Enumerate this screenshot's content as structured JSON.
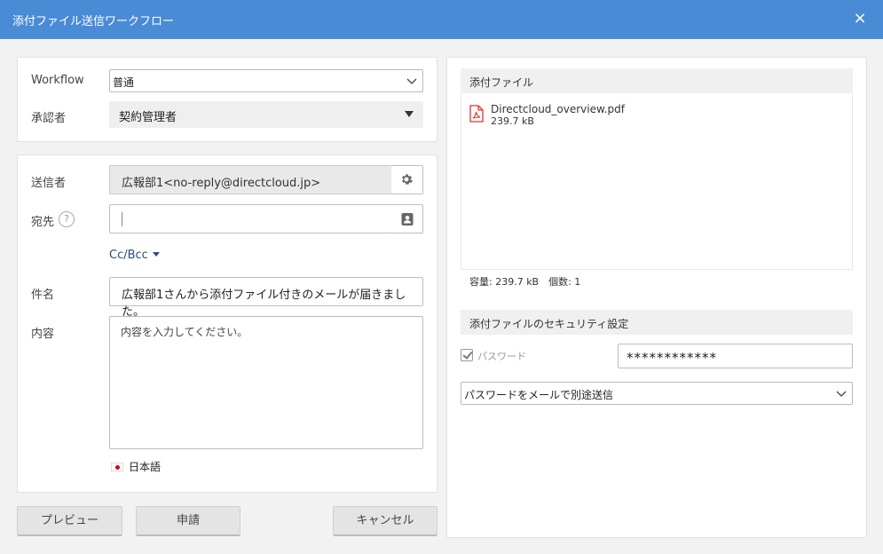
{
  "window": {
    "title": "添付ファイル送信ワークフロー",
    "close_label": "×"
  },
  "workflow": {
    "label": "Workflow",
    "value": "普通",
    "approver_label": "承認者",
    "approver_value": "契約管理者"
  },
  "mail": {
    "sender_label": "送信者",
    "sender_value": "広報部1<no-reply@directcloud.jp>",
    "to_label": "宛先",
    "help_label": "?",
    "to_value": "",
    "ccbcc_label": "Cc/Bcc",
    "subject_label": "件名",
    "subject_value": "広報部1さんから添付ファイル付きのメールが届きました。",
    "body_label": "内容",
    "body_placeholder": "内容を入力してください。",
    "language": "日本語"
  },
  "buttons": {
    "preview": "プレビュー",
    "apply": "申請",
    "cancel": "キャンセル"
  },
  "attachments": {
    "header": "添付ファイル",
    "files": [
      {
        "name": "Directcloud_overview.pdf",
        "size": "239.7 kB"
      }
    ],
    "summary": "容量: 239.7 kB　個数: 1"
  },
  "security": {
    "header": "添付ファイルのセキュリティ設定",
    "password_label": "パスワード",
    "password_checked": true,
    "password_value": "************",
    "delivery_method": "パスワードをメールで別途送信"
  },
  "icons": {
    "close": "close-icon",
    "gear": "gear-icon",
    "contacts": "address-book-icon",
    "pdf": "pdf-file-icon",
    "chevron": "chevron-down-icon"
  },
  "colors": {
    "titlebar": "#4a8bd6",
    "link": "#2c4d7a",
    "pdf_red": "#e0342c"
  }
}
